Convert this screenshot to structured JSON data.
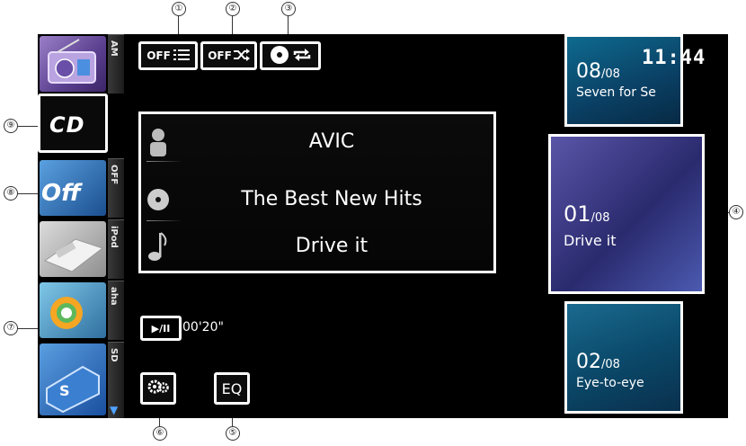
{
  "sidebar": {
    "sources": [
      {
        "tab": "AM",
        "thumb": "radio-icon"
      },
      {
        "tab": "",
        "label": "CD"
      },
      {
        "tab": "OFF",
        "label": "Off"
      },
      {
        "tab": "iPod",
        "thumb": "ipod-connector-icon"
      },
      {
        "tab": "aha",
        "thumb": "aha-icon"
      },
      {
        "tab": "SD",
        "thumb": "sd-card-icon"
      }
    ],
    "more": "▼"
  },
  "top_icons": {
    "scan_label": "OFF",
    "random_label": "OFF"
  },
  "info": {
    "artist": "AVIC",
    "album": "The Best New Hits",
    "track": "Drive it"
  },
  "playback": {
    "play_pause_label": "▶/II",
    "elapsed": "00'20\""
  },
  "bottom": {
    "eq_label": "EQ"
  },
  "tiles": [
    {
      "num": "08",
      "total": "/08",
      "name": "Seven for Se"
    },
    {
      "num": "01",
      "total": "/08",
      "name": "Drive it"
    },
    {
      "num": "02",
      "total": "/08",
      "name": "Eye-to-eye"
    }
  ],
  "clock": "11:44",
  "callouts": [
    "①",
    "②",
    "③",
    "④",
    "⑤",
    "⑥",
    "⑦",
    "⑧",
    "⑨"
  ],
  "colors": {
    "accent": "#4fa3ff",
    "background": "#000000",
    "frame": "#ffffff"
  }
}
